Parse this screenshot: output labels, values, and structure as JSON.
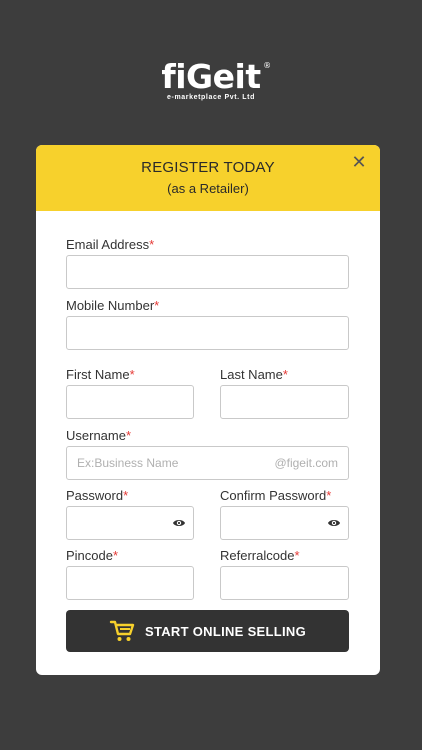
{
  "logo": {
    "name": "fiGeit",
    "reg": "®",
    "tagline": "e-marketplace Pvt. Ltd"
  },
  "header": {
    "title": "REGISTER TODAY",
    "subtitle": "(as a Retailer)",
    "close_symbol": "✕"
  },
  "form": {
    "required_mark": "*",
    "email": {
      "label": "Email Address"
    },
    "mobile": {
      "label": "Mobile Number"
    },
    "first_name": {
      "label": "First Name"
    },
    "last_name": {
      "label": "Last Name"
    },
    "username": {
      "label": "Username",
      "placeholder": "Ex:Business Name",
      "suffix": "@figeit.com"
    },
    "password": {
      "label": "Password"
    },
    "confirm_password": {
      "label": "Confirm Password"
    },
    "pincode": {
      "label": "Pincode"
    },
    "referralcode": {
      "label": "Referralcode"
    }
  },
  "cta": {
    "label": "START ONLINE SELLING"
  },
  "colors": {
    "background": "#3d3d3d",
    "header": "#f7d12c",
    "button": "#333333",
    "required": "#e53935"
  }
}
